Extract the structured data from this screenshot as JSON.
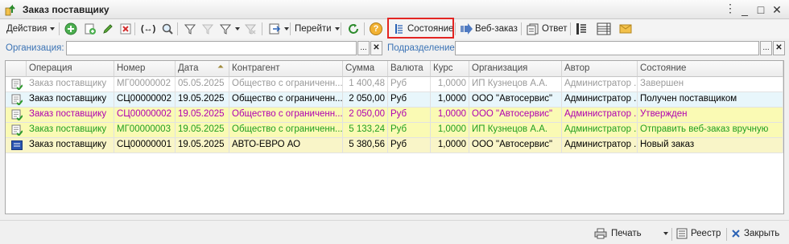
{
  "window": {
    "title": "Заказ поставщику",
    "minimize": "_",
    "maximize": "□",
    "close": "✕"
  },
  "toolbar": {
    "actions_label": "Действия",
    "goto_label": "Перейти",
    "status_label": "Состояние",
    "web_order_label": "Веб-заказ",
    "reply_label": "Ответ",
    "help_label": "?"
  },
  "filters": {
    "org_label": "Организация:",
    "dept_label": "Подразделение:",
    "org_value": "",
    "dept_value": "",
    "select_btn": "...",
    "clear_btn": "✕"
  },
  "table": {
    "columns": [
      "Операция",
      "Номер",
      "Дата",
      "Контрагент",
      "Сумма",
      "Валюта",
      "Курс",
      "Организация",
      "Автор",
      "Состояние"
    ],
    "sort_indicator": "⏶",
    "rows": [
      {
        "style": "gray",
        "icon": "order-posted-icon",
        "cells": [
          "Заказ поставщику",
          "МГ00000002",
          "05.05.2025",
          "Общество с ограниченн...",
          "1 400,48",
          "Руб",
          "1,0000",
          "ИП Кузнецов А.А.",
          "Администратор ...",
          "Завершен"
        ]
      },
      {
        "style": "lightblue",
        "icon": "order-posted-icon",
        "cells": [
          "Заказ поставщику",
          "СЦ00000002",
          "19.05.2025",
          "Общество с ограниченн...",
          "2 050,00",
          "Руб",
          "1,0000",
          "ООО \"Автосервис\"",
          "Администратор ...",
          "Получен поставщиком"
        ]
      },
      {
        "style": "purple",
        "icon": "order-posted-icon",
        "cells": [
          "Заказ поставщику",
          "СЦ00000002",
          "19.05.2025",
          "Общество с ограниченн...",
          "2 050,00",
          "Руб",
          "1,0000",
          "ООО \"Автосервис\"",
          "Администратор ...",
          "Утвержден"
        ]
      },
      {
        "style": "green",
        "icon": "order-posted-icon",
        "cells": [
          "Заказ поставщику",
          "МГ00000003",
          "19.05.2025",
          "Общество с ограниченн...",
          "5 133,24",
          "Руб",
          "1,0000",
          "ИП Кузнецов А.А.",
          "Администратор ...",
          "Отправить веб-заказ вручную"
        ]
      },
      {
        "style": "selected",
        "icon": "order-draft-icon",
        "cells": [
          "Заказ поставщику",
          "СЦ00000001",
          "19.05.2025",
          "АВТО-ЕВРО АО",
          "5 380,56",
          "Руб",
          "1,0000",
          "ООО \"Автосервис\"",
          "Администратор ...",
          "Новый заказ"
        ]
      }
    ]
  },
  "colors": {
    "highlight": "#e32522",
    "gray_text": "#9a9a9a",
    "purple_text": "#b000b0",
    "green_text": "#209e20",
    "lightblue_bg": "#e8f6fb",
    "yellow_bg": "#fafab4",
    "selected_bg": "#f9f5c8"
  },
  "footer": {
    "print_label": "Печать",
    "registry_label": "Реестр",
    "close_label": "Закрыть"
  }
}
